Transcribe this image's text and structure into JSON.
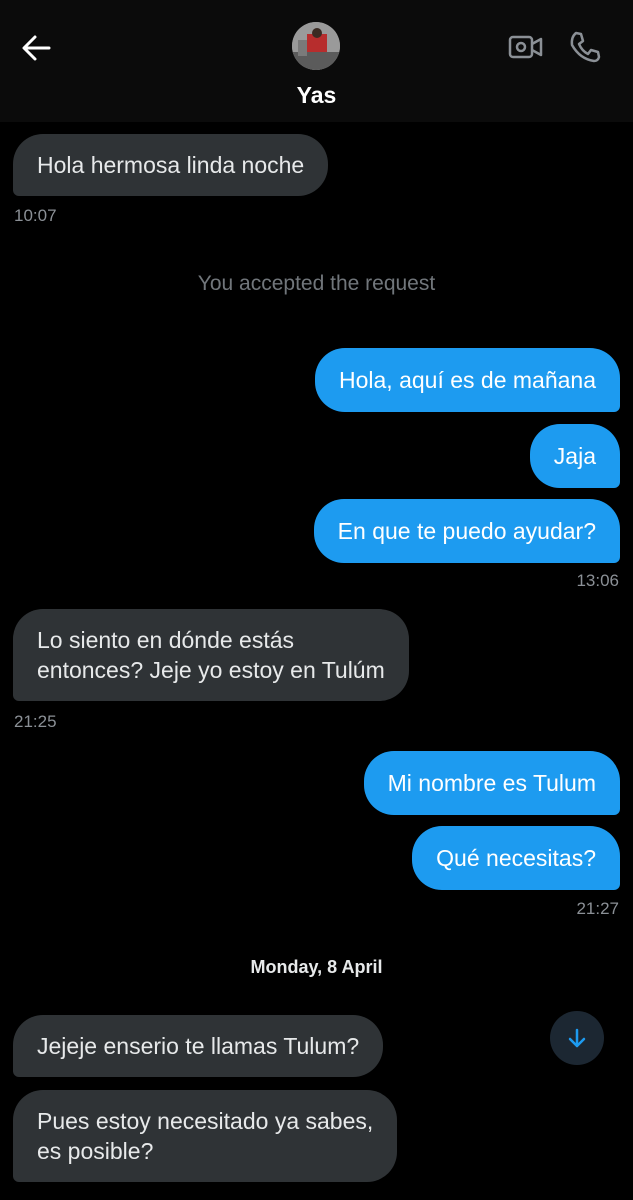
{
  "header": {
    "contact_name": "Yas",
    "icons": [
      "back-arrow-icon",
      "avatar",
      "video-call-icon",
      "phone-call-icon"
    ]
  },
  "messages": {
    "m1": {
      "text": "Hola hermosa linda noche",
      "time": "10:07",
      "direction": "incoming"
    },
    "system_note": "You accepted the request",
    "m2": {
      "text": "Hola, aquí es de mañana",
      "direction": "outgoing"
    },
    "m3": {
      "text": "Jaja",
      "direction": "outgoing"
    },
    "m4": {
      "text": "En que te puedo ayudar?",
      "time": "13:06",
      "direction": "outgoing"
    },
    "m5": {
      "text": "Lo siento en dónde estás\nentonces? Jeje yo estoy en Tulúm",
      "time": "21:25",
      "direction": "incoming"
    },
    "m6": {
      "text": "Mi nombre es Tulum",
      "direction": "outgoing"
    },
    "m7": {
      "text": "Qué necesitas?",
      "time": "21:27",
      "direction": "outgoing"
    },
    "date_divider": "Monday, 8 April",
    "m8": {
      "text": "Jejeje enserio te llamas Tulum?",
      "direction": "incoming"
    },
    "m9": {
      "text": "Pues estoy necesitado ya sabes,\nes posible?",
      "direction": "incoming"
    }
  },
  "colors": {
    "background": "#000000",
    "incoming_bubble": "#2f3336",
    "outgoing_bubble": "#1d9bf0",
    "timestamp": "#8b9096"
  }
}
